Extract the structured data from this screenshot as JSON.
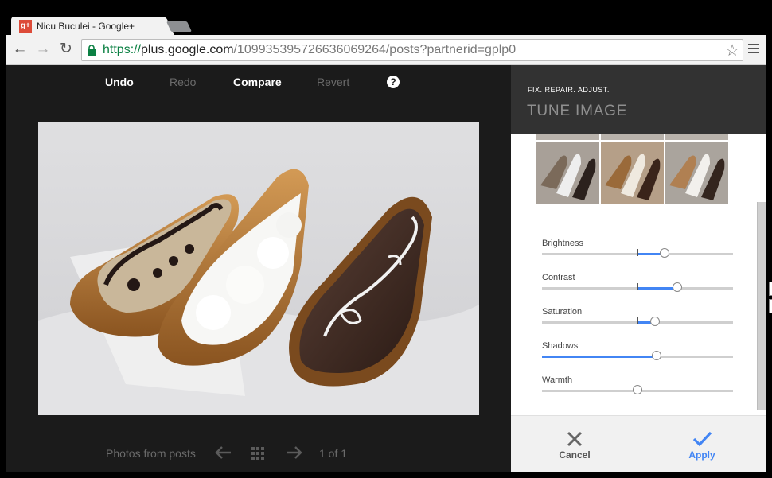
{
  "browser": {
    "tab_title": "Nicu Buculei - Google+",
    "favicon_label": "g+",
    "url_scheme": "https://",
    "url_host": "plus.google.com",
    "url_path": "/109935395726636069264/posts?partnerid=gplp0",
    "icons": [
      "back-icon",
      "forward-icon",
      "reload-icon",
      "lock-icon",
      "star-icon",
      "menu-icon"
    ]
  },
  "editor": {
    "undo_label": "Undo",
    "redo_label": "Redo",
    "compare_label": "Compare",
    "revert_label": "Revert",
    "help_label": "?"
  },
  "footer": {
    "source_label": "Photos from posts",
    "page_indicator": "1 of 1"
  },
  "panel": {
    "subtitle": "FIX. REPAIR. ADJUST.",
    "title": "TUNE IMAGE",
    "sliders": [
      {
        "label": "Brightness",
        "value": 0.64,
        "center": 0.5
      },
      {
        "label": "Contrast",
        "value": 0.71,
        "center": 0.5
      },
      {
        "label": "Saturation",
        "value": 0.59,
        "center": 0.5
      },
      {
        "label": "Shadows",
        "value": 0.6,
        "center": 0.0
      },
      {
        "label": "Warmth",
        "value": 0.5,
        "center": 0.5
      }
    ],
    "cancel_label": "Cancel",
    "apply_label": "Apply"
  },
  "colors": {
    "accent": "#4285f4",
    "viewer_bg": "#1b1b1b",
    "panel_header_bg": "#323232",
    "secure_green": "#0b8043"
  }
}
